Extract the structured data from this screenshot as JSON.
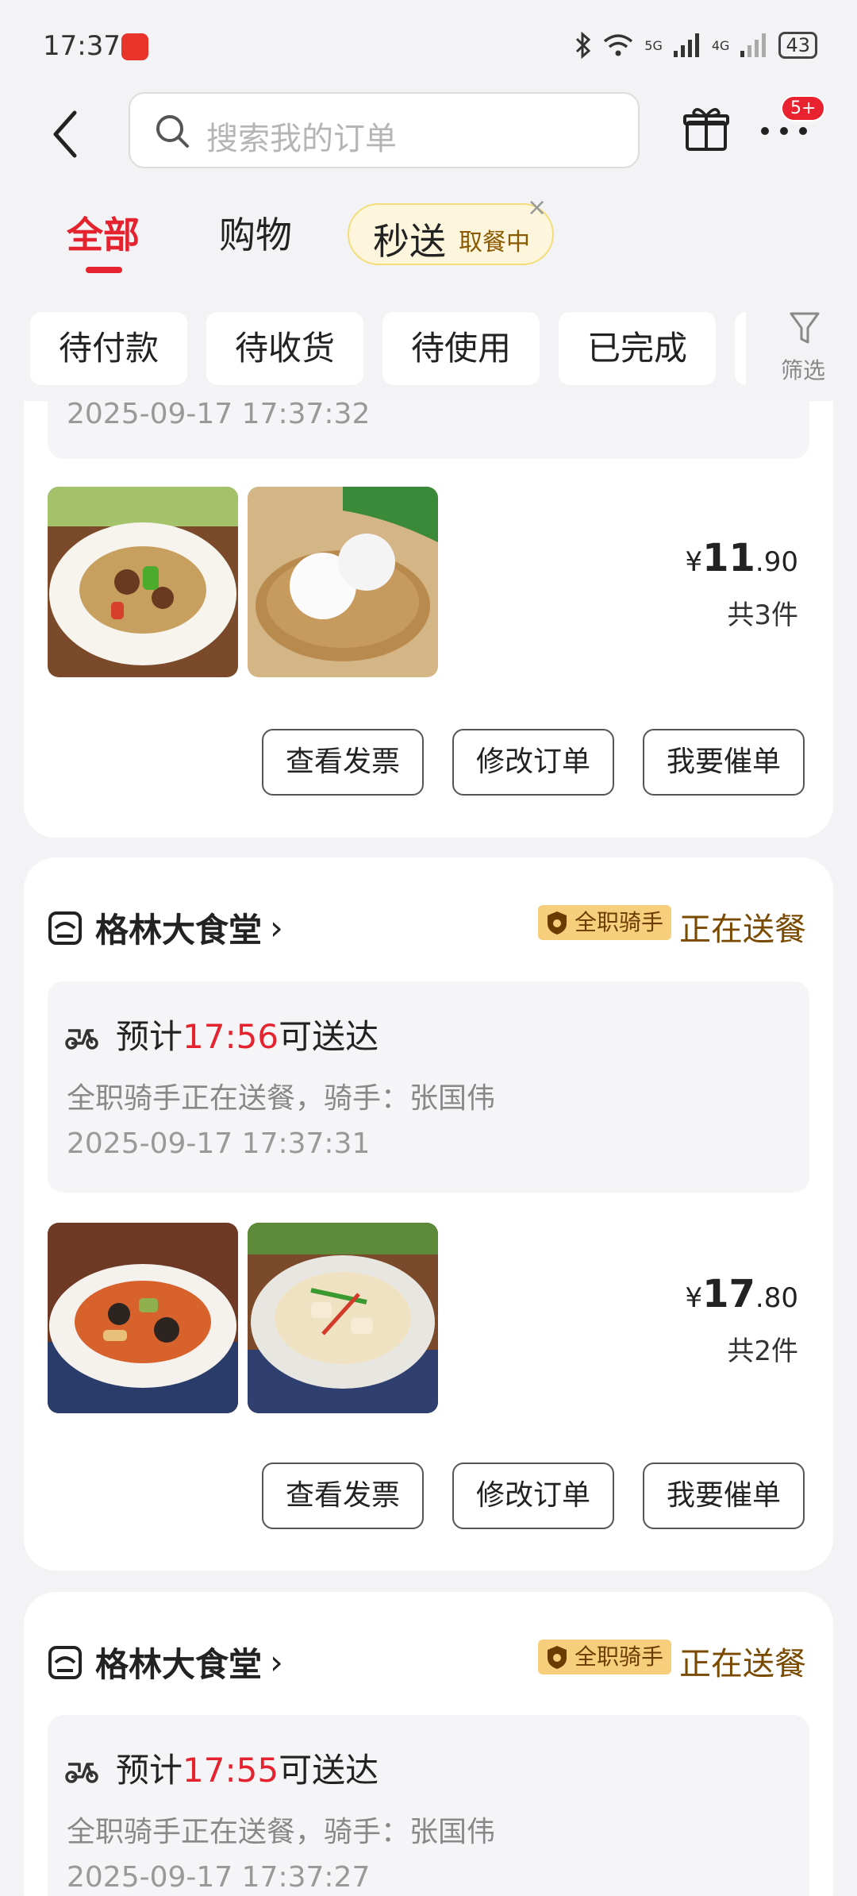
{
  "status_bar": {
    "time": "17:37",
    "signal1": "5G",
    "signal2": "4G",
    "battery": "43"
  },
  "search": {
    "placeholder": "搜索我的订单"
  },
  "header": {
    "badge": "5+"
  },
  "tabs": [
    {
      "label": "全部",
      "active": true
    },
    {
      "label": "购物",
      "active": false
    }
  ],
  "express_tab": {
    "label": "秒送",
    "sub": "取餐中",
    "close": "×"
  },
  "filters": [
    "待付款",
    "待收货",
    "待使用",
    "已完成"
  ],
  "filter_button": "筛选",
  "orders": [
    {
      "timestamp": "2025-09-17 17:37:32",
      "price_symbol": "¥",
      "price_int": "11",
      "price_dec": ".90",
      "count": "共3件",
      "buttons": [
        "查看发票",
        "修改订单",
        "我要催单"
      ]
    },
    {
      "store": "格林大食堂",
      "chevron": "›",
      "rider_tag": "全职骑手",
      "status": "正在送餐",
      "eta_prefix": "预计",
      "eta_time": "17:56",
      "eta_suffix": "可送达",
      "rider_info": "全职骑手正在送餐，骑手：张国伟",
      "timestamp": "2025-09-17 17:37:31",
      "price_symbol": "¥",
      "price_int": "17",
      "price_dec": ".80",
      "count": "共2件",
      "buttons": [
        "查看发票",
        "修改订单",
        "我要催单"
      ]
    },
    {
      "store": "格林大食堂",
      "chevron": "›",
      "rider_tag": "全职骑手",
      "status": "正在送餐",
      "eta_prefix": "预计",
      "eta_time": "17:55",
      "eta_suffix": "可送达",
      "rider_info": "全职骑手正在送餐，骑手：张国伟",
      "timestamp": "2025-09-17 17:37:27"
    }
  ],
  "colors": {
    "accent": "#e5232e",
    "status_brown": "#7a4a00",
    "rider_tag_bg": "#f7cf7c"
  }
}
